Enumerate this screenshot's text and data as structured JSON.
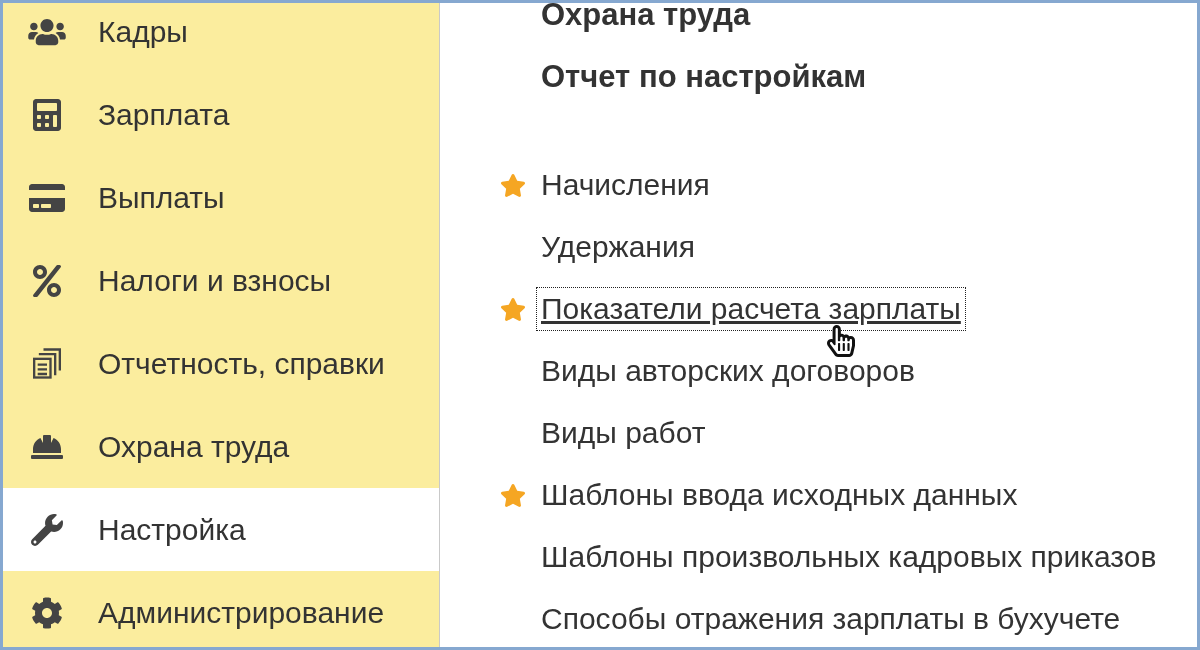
{
  "sections": [
    {
      "label": "Кадры",
      "selected": false
    },
    {
      "label": "Зарплата",
      "selected": false
    },
    {
      "label": "Выплаты",
      "selected": false
    },
    {
      "label": "Налоги и взносы",
      "selected": false
    },
    {
      "label": "Отчетность, справки",
      "selected": false
    },
    {
      "label": "Охрана труда",
      "selected": false
    },
    {
      "label": "Настройка",
      "selected": true
    },
    {
      "label": "Администрирование",
      "selected": false
    }
  ],
  "commands": {
    "groups": [
      {
        "links": [
          {
            "text": "Охрана труда",
            "important": true,
            "favorite": false,
            "focused": false
          },
          {
            "text": "Отчет по настройкам",
            "important": true,
            "favorite": false,
            "focused": false
          }
        ]
      },
      {
        "links": [
          {
            "text": "Начисления",
            "important": false,
            "favorite": true,
            "focused": false
          },
          {
            "text": "Удержания",
            "important": false,
            "favorite": false,
            "focused": false
          },
          {
            "text": "Показатели расчета зарплаты",
            "important": false,
            "favorite": true,
            "focused": true
          },
          {
            "text": "Виды авторских договоров",
            "important": false,
            "favorite": false,
            "focused": false
          },
          {
            "text": "Виды работ",
            "important": false,
            "favorite": false,
            "focused": false
          },
          {
            "text": "Шаблоны ввода исходных данных",
            "important": false,
            "favorite": true,
            "focused": false
          },
          {
            "text": "Шаблоны произвольных кадровых приказов",
            "important": false,
            "favorite": false,
            "focused": false
          },
          {
            "text": "Способы отражения зарплаты в бухучете",
            "important": false,
            "favorite": false,
            "focused": false
          }
        ]
      }
    ]
  }
}
